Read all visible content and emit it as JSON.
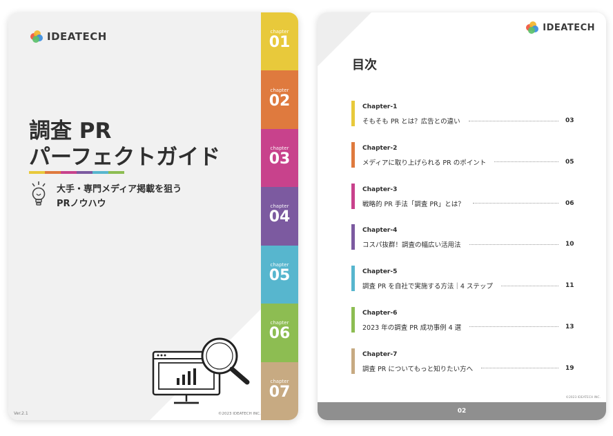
{
  "colors": {
    "ch1": "#e8c93b",
    "ch2": "#df7a3e",
    "ch3": "#c8428c",
    "ch4": "#7c5aa0",
    "ch5": "#57b6ce",
    "ch6": "#8dbd52",
    "ch7": "#c7aa82"
  },
  "cover": {
    "logo": "IDEATECH",
    "title_line1": "調査 PR",
    "title_line2": "パーフェクトガイド",
    "subtitle": "大手・専門メディア掲載を狙う\nPRノウハウ",
    "version": "Ver.2.1",
    "copyright": "©2023 IDEATECH INC.",
    "tabs": [
      {
        "label": "chapter",
        "num": "01"
      },
      {
        "label": "chapter",
        "num": "02"
      },
      {
        "label": "chapter",
        "num": "03"
      },
      {
        "label": "chapter",
        "num": "04"
      },
      {
        "label": "chapter",
        "num": "05"
      },
      {
        "label": "chapter",
        "num": "06"
      },
      {
        "label": "chapter",
        "num": "07"
      }
    ]
  },
  "toc": {
    "logo": "IDEATECH",
    "heading": "目次",
    "items": [
      {
        "chapter": "Chapter-1",
        "title": "そもそも PR とは？広告との違い",
        "page": "03"
      },
      {
        "chapter": "Chapter-2",
        "title": "メディアに取り上げられる PR のポイント",
        "page": "05"
      },
      {
        "chapter": "Chapter-3",
        "title": "戦略的 PR 手法「調査 PR」とは？",
        "page": "06"
      },
      {
        "chapter": "Chapter-4",
        "title": "コスパ抜群！調査の幅広い活用法",
        "page": "10"
      },
      {
        "chapter": "Chapter-5",
        "title": "調査 PR を自社で実施する方法｜4 ステップ",
        "page": "11"
      },
      {
        "chapter": "Chapter-6",
        "title": "2023 年の調査 PR 成功事例 4 選",
        "page": "13"
      },
      {
        "chapter": "Chapter-7",
        "title": "調査 PR についてもっと知りたい方へ",
        "page": "19"
      }
    ],
    "small_copyright": "©2023 IDEATECH INC.",
    "footer_page": "02"
  }
}
